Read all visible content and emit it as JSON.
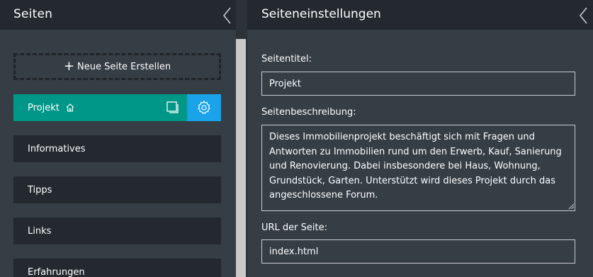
{
  "left_panel": {
    "title": "Seiten",
    "new_page_label": "Neue Seite Erstellen",
    "pages": [
      {
        "label": "Projekt",
        "active": true,
        "home": true
      },
      {
        "label": "Informatives"
      },
      {
        "label": "Tipps"
      },
      {
        "label": "Links"
      },
      {
        "label": "Erfahrungen"
      }
    ]
  },
  "right_panel": {
    "title": "Seiteneinstellungen",
    "title_field": {
      "label": "Seitentitel:",
      "value": "Projekt"
    },
    "description_field": {
      "label": "Seitenbeschreibung:",
      "value": "Dieses Immobilienprojekt beschäftigt sich mit Fragen und Antworten zu Immobilien rund um den Erwerb, Kauf, Sanierung und Renovierung. Dabei insbesondere bei Haus, Wohnung, Grundstück, Garten. Unterstützt wird dieses Projekt durch das angeschlossene Forum."
    },
    "url_field": {
      "label": "URL der Seite:",
      "value": "index.html"
    }
  },
  "colors": {
    "header_bg": "#23292e",
    "panel_bg": "#353e45",
    "active_page": "#009688",
    "settings_accent": "#1aa3e8"
  },
  "icons": {
    "collapse": "chevron-left-icon",
    "home": "home-icon",
    "copy": "copy-icon",
    "settings": "gear-icon",
    "add": "plus-icon"
  }
}
